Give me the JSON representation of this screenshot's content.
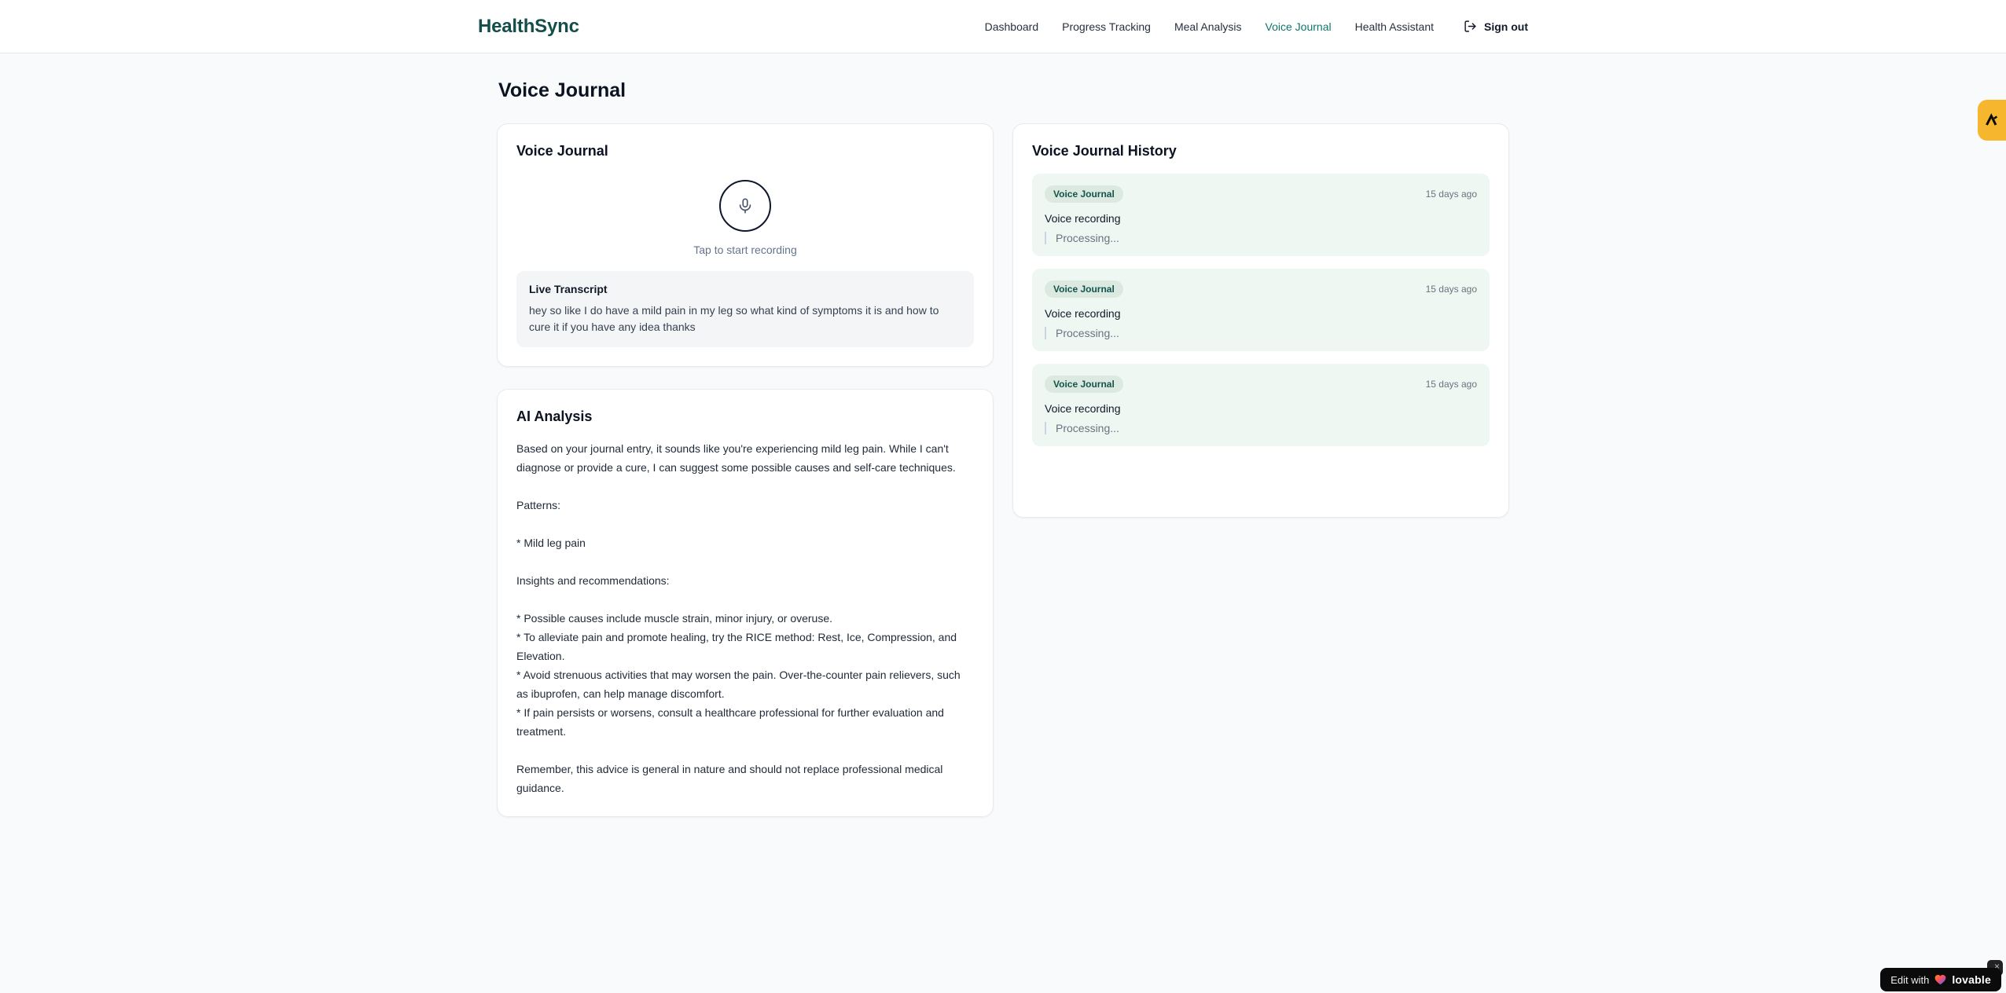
{
  "app": {
    "name": "HealthSync"
  },
  "nav": {
    "items": [
      {
        "label": "Dashboard",
        "active": false
      },
      {
        "label": "Progress Tracking",
        "active": false
      },
      {
        "label": "Meal Analysis",
        "active": false
      },
      {
        "label": "Voice Journal",
        "active": true
      },
      {
        "label": "Health Assistant",
        "active": false
      }
    ],
    "sign_out_label": "Sign out"
  },
  "page": {
    "title": "Voice Journal"
  },
  "recorder_card": {
    "title": "Voice Journal",
    "tap_hint": "Tap to start recording",
    "transcript_title": "Live Transcript",
    "transcript_text": "hey so like I do have a mild pain in my leg so what kind of symptoms it is and how to cure it if you have any idea thanks"
  },
  "analysis_card": {
    "title": "AI Analysis",
    "body": "Based on your journal entry, it sounds like you're experiencing mild leg pain. While I can't diagnose or provide a cure, I can suggest some possible causes and self-care techniques.\n\nPatterns:\n\n* Mild leg pain\n\nInsights and recommendations:\n\n* Possible causes include muscle strain, minor injury, or overuse.\n* To alleviate pain and promote healing, try the RICE method: Rest, Ice, Compression, and Elevation.\n* Avoid strenuous activities that may worsen the pain. Over-the-counter pain relievers, such as ibuprofen, can help manage discomfort.\n* If pain persists or worsens, consult a healthcare professional for further evaluation and treatment.\n\nRemember, this advice is general in nature and should not replace professional medical guidance."
  },
  "history_card": {
    "title": "Voice Journal History",
    "entries": [
      {
        "badge": "Voice Journal",
        "time": "15 days ago",
        "label": "Voice recording",
        "status": "Processing..."
      },
      {
        "badge": "Voice Journal",
        "time": "15 days ago",
        "label": "Voice recording",
        "status": "Processing..."
      },
      {
        "badge": "Voice Journal",
        "time": "15 days ago",
        "label": "Voice recording",
        "status": "Processing..."
      }
    ]
  },
  "widgets": {
    "lovable": {
      "edit_with": "Edit with",
      "brand": "lovable",
      "close": "×"
    }
  },
  "colors": {
    "brand_logo": "#134e4a",
    "nav_active": "#0f766e",
    "page_bg": "#f8fafc",
    "card_border": "#e8eaef",
    "entry_bg": "#eff7f2",
    "badge_bg": "#dbe9e1",
    "badge_text": "#14534b",
    "side_widget_bg": "#f6b62e",
    "lovable_bg": "#0b0b0c"
  }
}
